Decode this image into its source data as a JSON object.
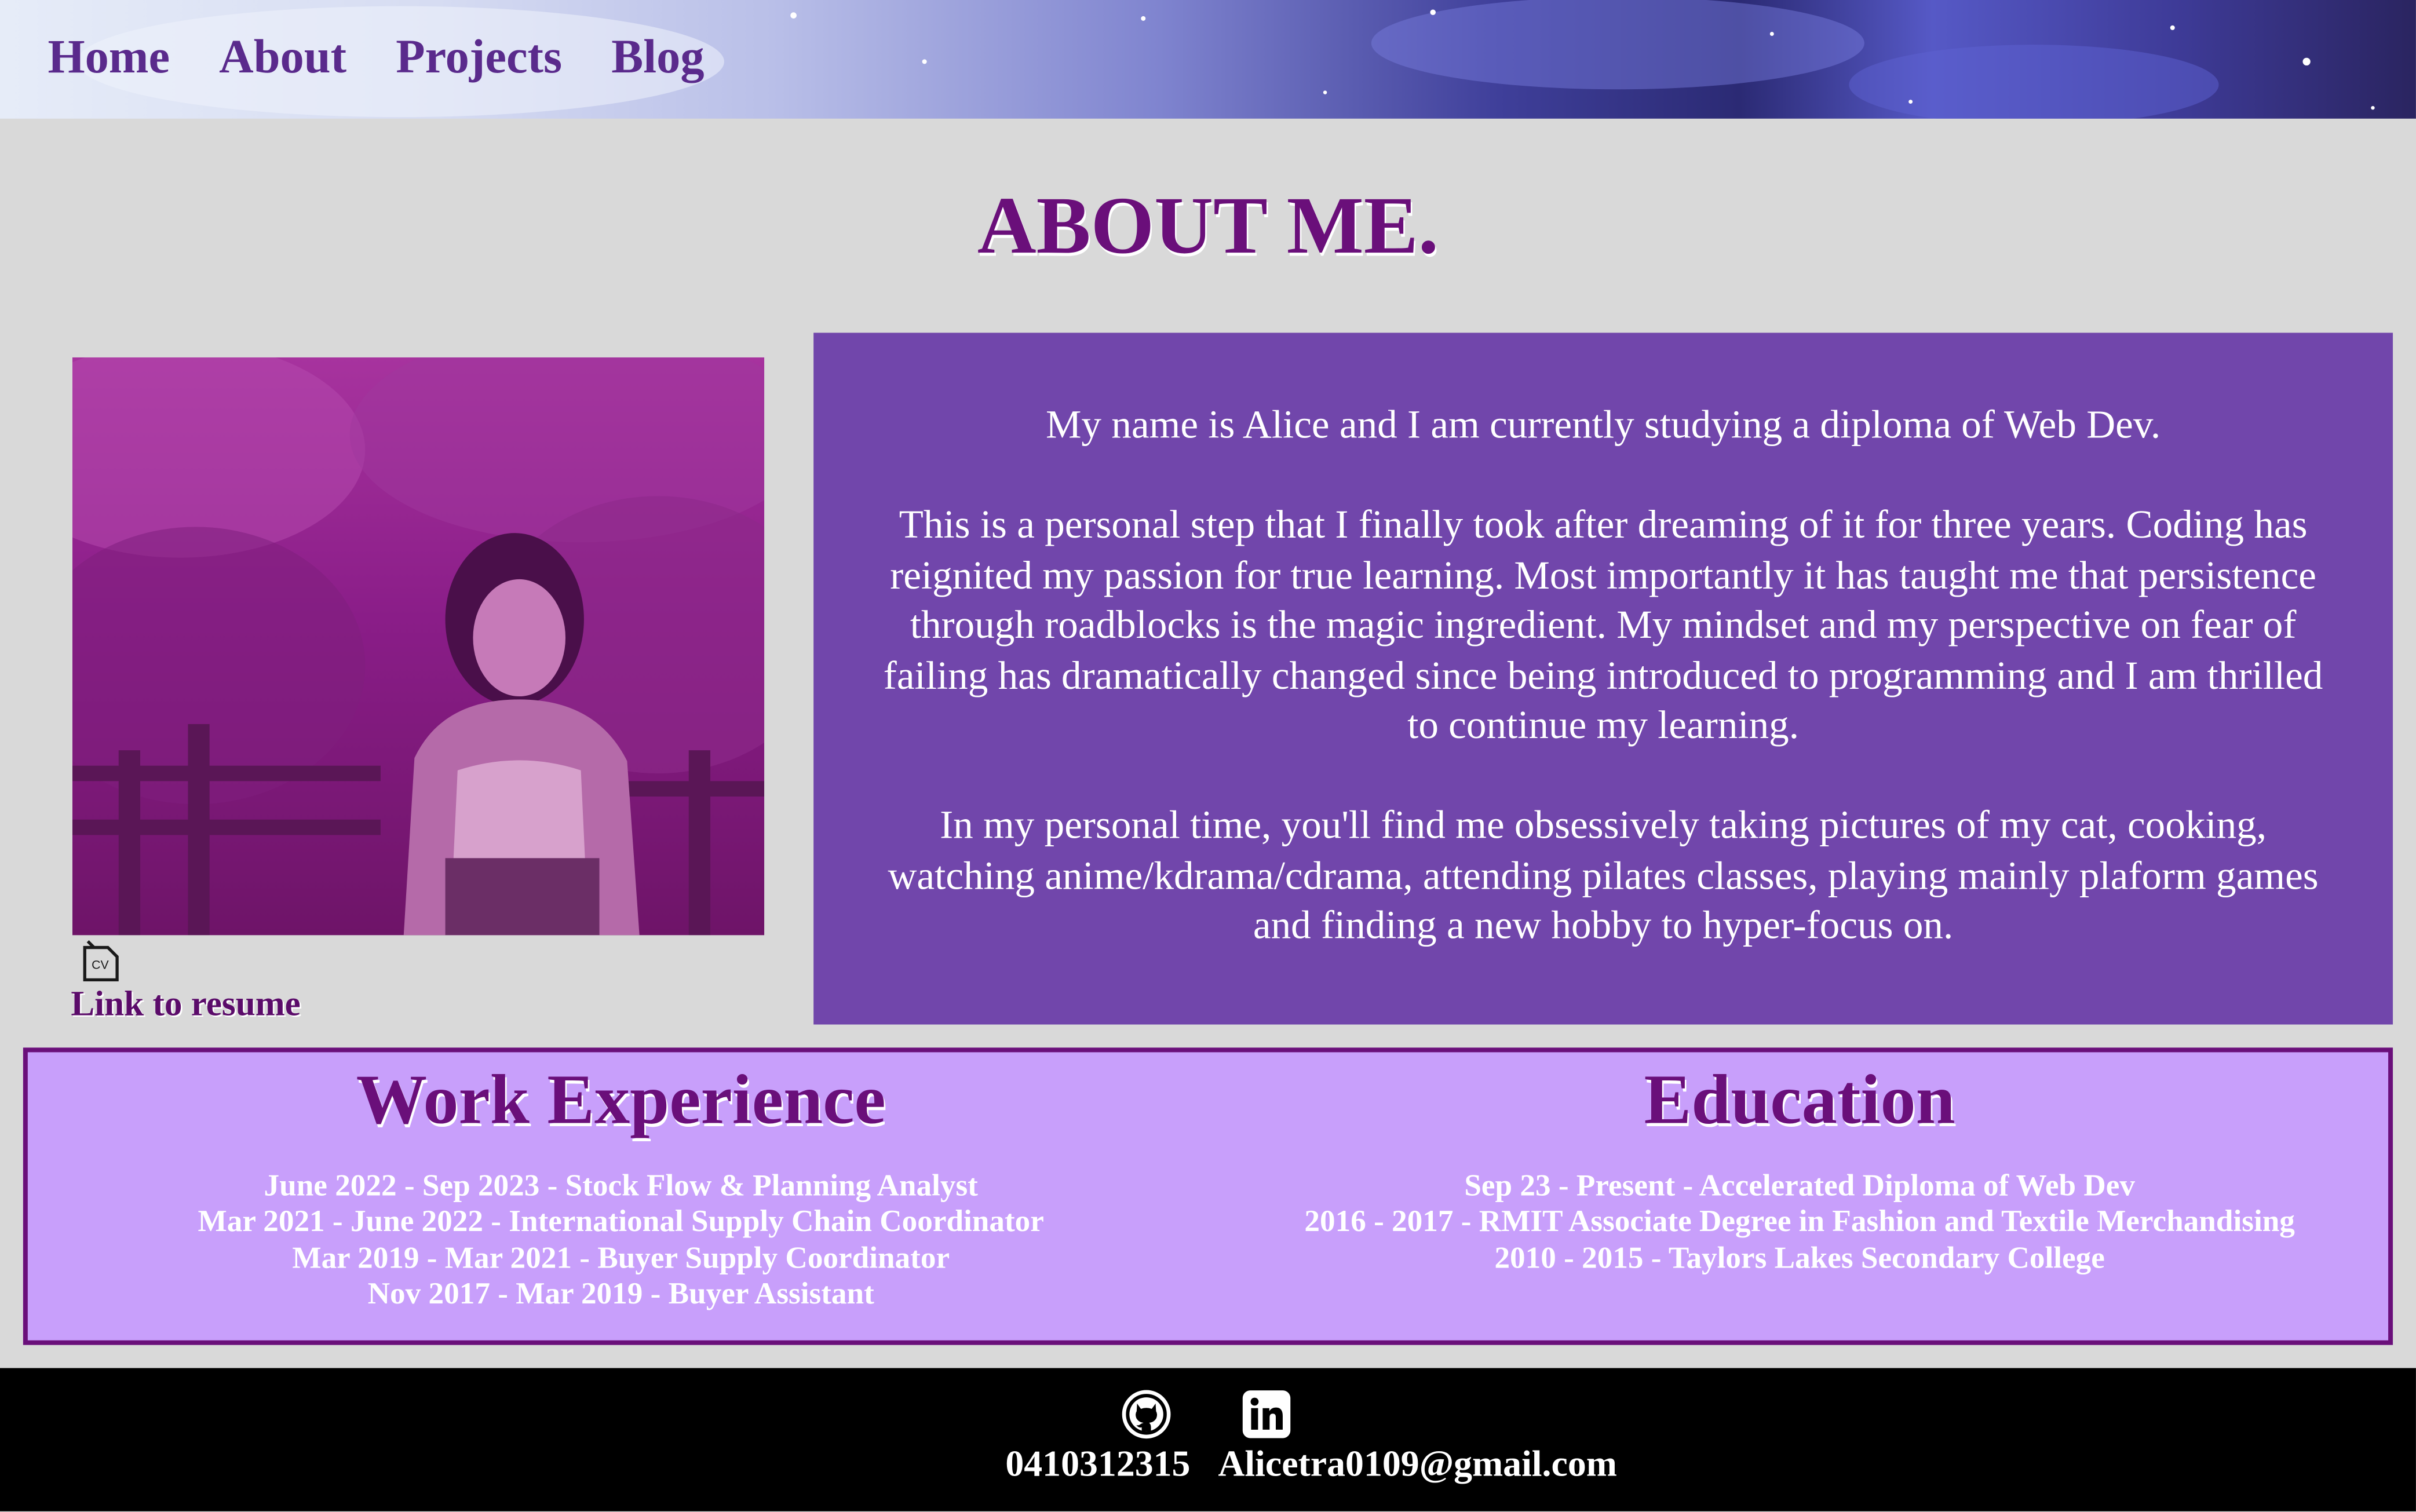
{
  "nav": {
    "items": [
      {
        "label": "Home"
      },
      {
        "label": "About"
      },
      {
        "label": "Projects"
      },
      {
        "label": "Blog"
      }
    ]
  },
  "page_title": "ABOUT ME.",
  "resume": {
    "icon_text": "CV",
    "link_label": "Link to resume"
  },
  "bio": {
    "paragraphs": [
      "My name is Alice and I am currently studying a diploma of Web Dev.",
      "This is a personal step that I finally took after dreaming of it for three years. Coding has reignited my passion for true learning. Most importantly it has taught me that persistence through roadblocks is the magic ingredient. My mindset and my perspective on fear of failing has dramatically changed since being introduced to programming and I am thrilled to continue my learning.",
      "In my personal time, you'll find me obsessively taking pictures of my cat, cooking, watching anime/kdrama/cdrama, attending pilates classes, playing mainly plaform games and finding a new hobby to hyper-focus on."
    ]
  },
  "work": {
    "heading": "Work Experience",
    "items": [
      "June 2022 - Sep 2023 - Stock Flow & Planning Analyst",
      "Mar 2021 - June 2022 - International Supply Chain Coordinator",
      "Mar 2019 - Mar 2021 - Buyer Supply Coordinator",
      "Nov 2017 - Mar 2019 - Buyer Assistant"
    ]
  },
  "education": {
    "heading": "Education",
    "items": [
      "Sep 23 - Present - Accelerated Diploma of Web Dev",
      "2016 - 2017 - RMIT Associate Degree in Fashion and Textile Merchandising",
      "2010 - 2015 - Taylors Lakes Secondary College"
    ]
  },
  "footer": {
    "icons": [
      "github-icon",
      "linkedin-icon"
    ],
    "phone": "0410312315",
    "email": "Alicetra0109@gmail.com"
  },
  "colors": {
    "accent_purple": "#6a0f7a",
    "bio_background": "#7146ab",
    "info_background": "#c89ffb",
    "page_background": "#d9d9d9",
    "footer_background": "#000000"
  }
}
